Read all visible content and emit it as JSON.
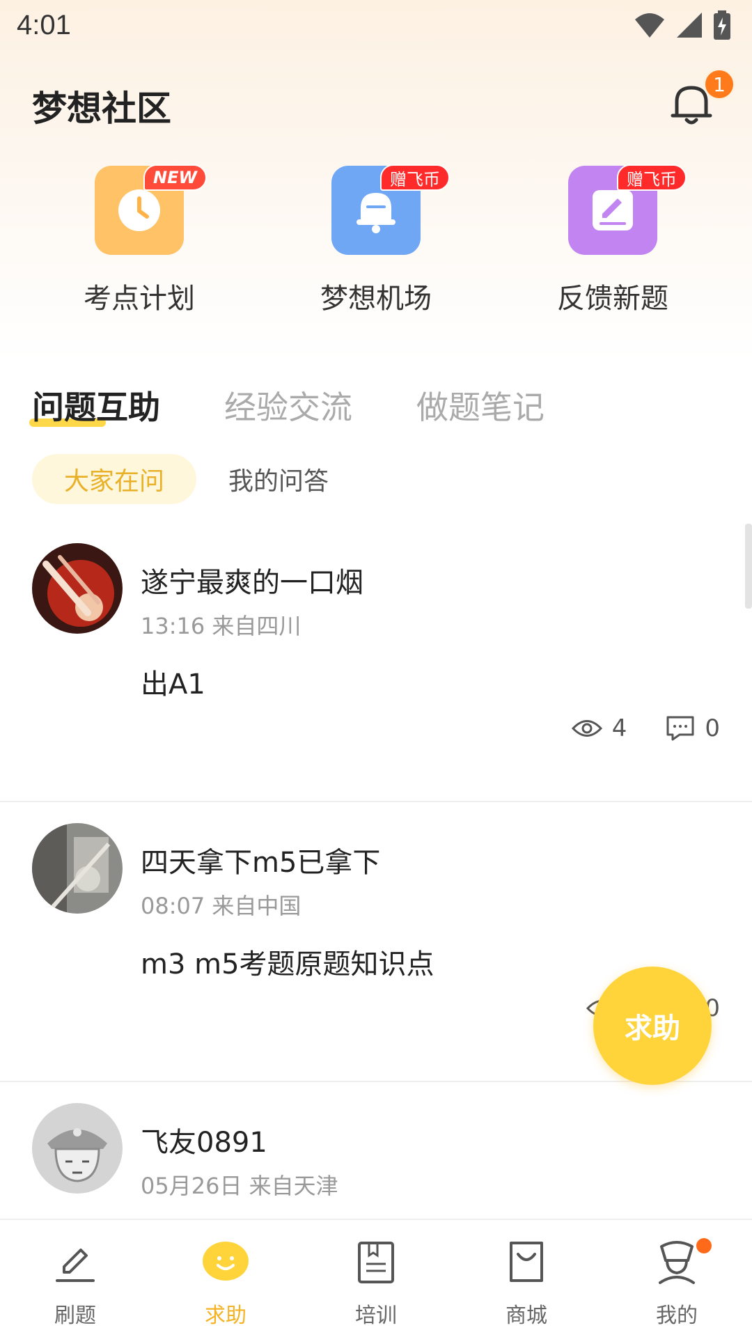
{
  "status": {
    "time": "4:01"
  },
  "header": {
    "title": "梦想社区",
    "notification_count": "1"
  },
  "features": [
    {
      "label": "考点计划",
      "badge": "NEW",
      "color": "#ffc266"
    },
    {
      "label": "梦想机场",
      "badge": "赠飞币",
      "color": "#6fa7f5"
    },
    {
      "label": "反馈新题",
      "badge": "赠飞币",
      "color": "#c184f0"
    }
  ],
  "tabs": [
    "问题互助",
    "经验交流",
    "做题笔记"
  ],
  "subtabs": [
    "大家在问",
    "我的问答"
  ],
  "posts": [
    {
      "user": "遂宁最爽的一口烟",
      "meta": "13:16 来自四川",
      "body": "出A1",
      "views": "4",
      "comments": "0"
    },
    {
      "user": "四天拿下m5已拿下",
      "meta": "08:07 来自中国",
      "body": "m3 m5考题原题知识点",
      "views": "",
      "comments": "0"
    },
    {
      "user": "飞友0891",
      "meta": "05月26日 来自天津"
    }
  ],
  "fab": {
    "label": "求助"
  },
  "bottom_nav": [
    {
      "label": "刷题",
      "icon": "pen-icon"
    },
    {
      "label": "求助",
      "icon": "smile-icon"
    },
    {
      "label": "培训",
      "icon": "book-icon"
    },
    {
      "label": "商城",
      "icon": "bag-icon"
    },
    {
      "label": "我的",
      "icon": "pilot-icon"
    }
  ],
  "colors": {
    "accent": "#ffd43b",
    "accent_text": "#f5b324",
    "badge": "#ff7a1a"
  }
}
